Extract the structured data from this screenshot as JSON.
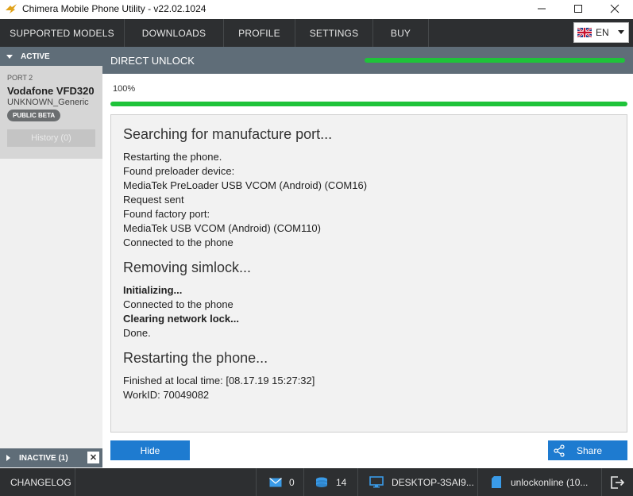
{
  "window": {
    "title": "Chimera Mobile Phone Utility - v22.02.1024",
    "controls": [
      "minimize-icon",
      "maximize-icon",
      "close-icon"
    ]
  },
  "nav": {
    "items": [
      {
        "label": "SUPPORTED MODELS"
      },
      {
        "label": "DOWNLOADS"
      },
      {
        "label": "PROFILE"
      },
      {
        "label": "SETTINGS"
      },
      {
        "label": "BUY"
      }
    ],
    "language": {
      "value": "EN",
      "flag": "uk-flag-icon"
    }
  },
  "sidebar": {
    "active_label": "ACTIVE",
    "device": {
      "port": "PORT 2",
      "name": "Vodafone VFD320",
      "model": "UNKNOWN_Generic",
      "badge": "PUBLIC BETA",
      "history": "History (0)"
    },
    "inactive_label": "INACTIVE (1)",
    "inactive_close": "✕"
  },
  "main": {
    "header": "DIRECT UNLOCK",
    "progress_percent_label": "100%",
    "progress": 1.0,
    "log": {
      "sections": [
        {
          "heading": "Searching for manufacture port...",
          "lines": [
            {
              "text": "Restarting the phone.",
              "bold": false
            },
            {
              "text": "Found preloader device:",
              "bold": false
            },
            {
              "text": "MediaTek PreLoader USB VCOM (Android) (COM16)",
              "bold": false
            },
            {
              "text": "Request sent",
              "bold": false
            },
            {
              "text": "Found factory port:",
              "bold": false
            },
            {
              "text": "MediaTek USB VCOM (Android) (COM110)",
              "bold": false
            },
            {
              "text": "Connected to the phone",
              "bold": false
            }
          ]
        },
        {
          "heading": "Removing simlock...",
          "lines": [
            {
              "text": "Initializing...",
              "bold": true
            },
            {
              "text": "Connected to the phone",
              "bold": false
            },
            {
              "text": "Clearing network lock...",
              "bold": true
            },
            {
              "text": "Done.",
              "bold": false
            }
          ]
        },
        {
          "heading": "Restarting the phone...",
          "lines": [
            {
              "text": "Finished at local time: [08.17.19 15:27:32]",
              "bold": false
            },
            {
              "text": "WorkID: 70049082",
              "bold": false
            }
          ]
        }
      ]
    },
    "hide_button": "Hide",
    "share_button": "Share"
  },
  "statusbar": {
    "changelog": "CHANGELOG",
    "messages_count": "0",
    "credits_count": "14",
    "computer": "DESKTOP-3SAI9...",
    "account": "unlockonline (10...",
    "icons": [
      "mail-icon",
      "coins-icon",
      "monitor-icon",
      "sim-card-icon",
      "logout-icon"
    ]
  },
  "colors": {
    "dark_bar": "#2d2f31",
    "header_slate": "#5f6d78",
    "progress_green": "#1fc33a",
    "button_blue": "#1e7bd0"
  }
}
